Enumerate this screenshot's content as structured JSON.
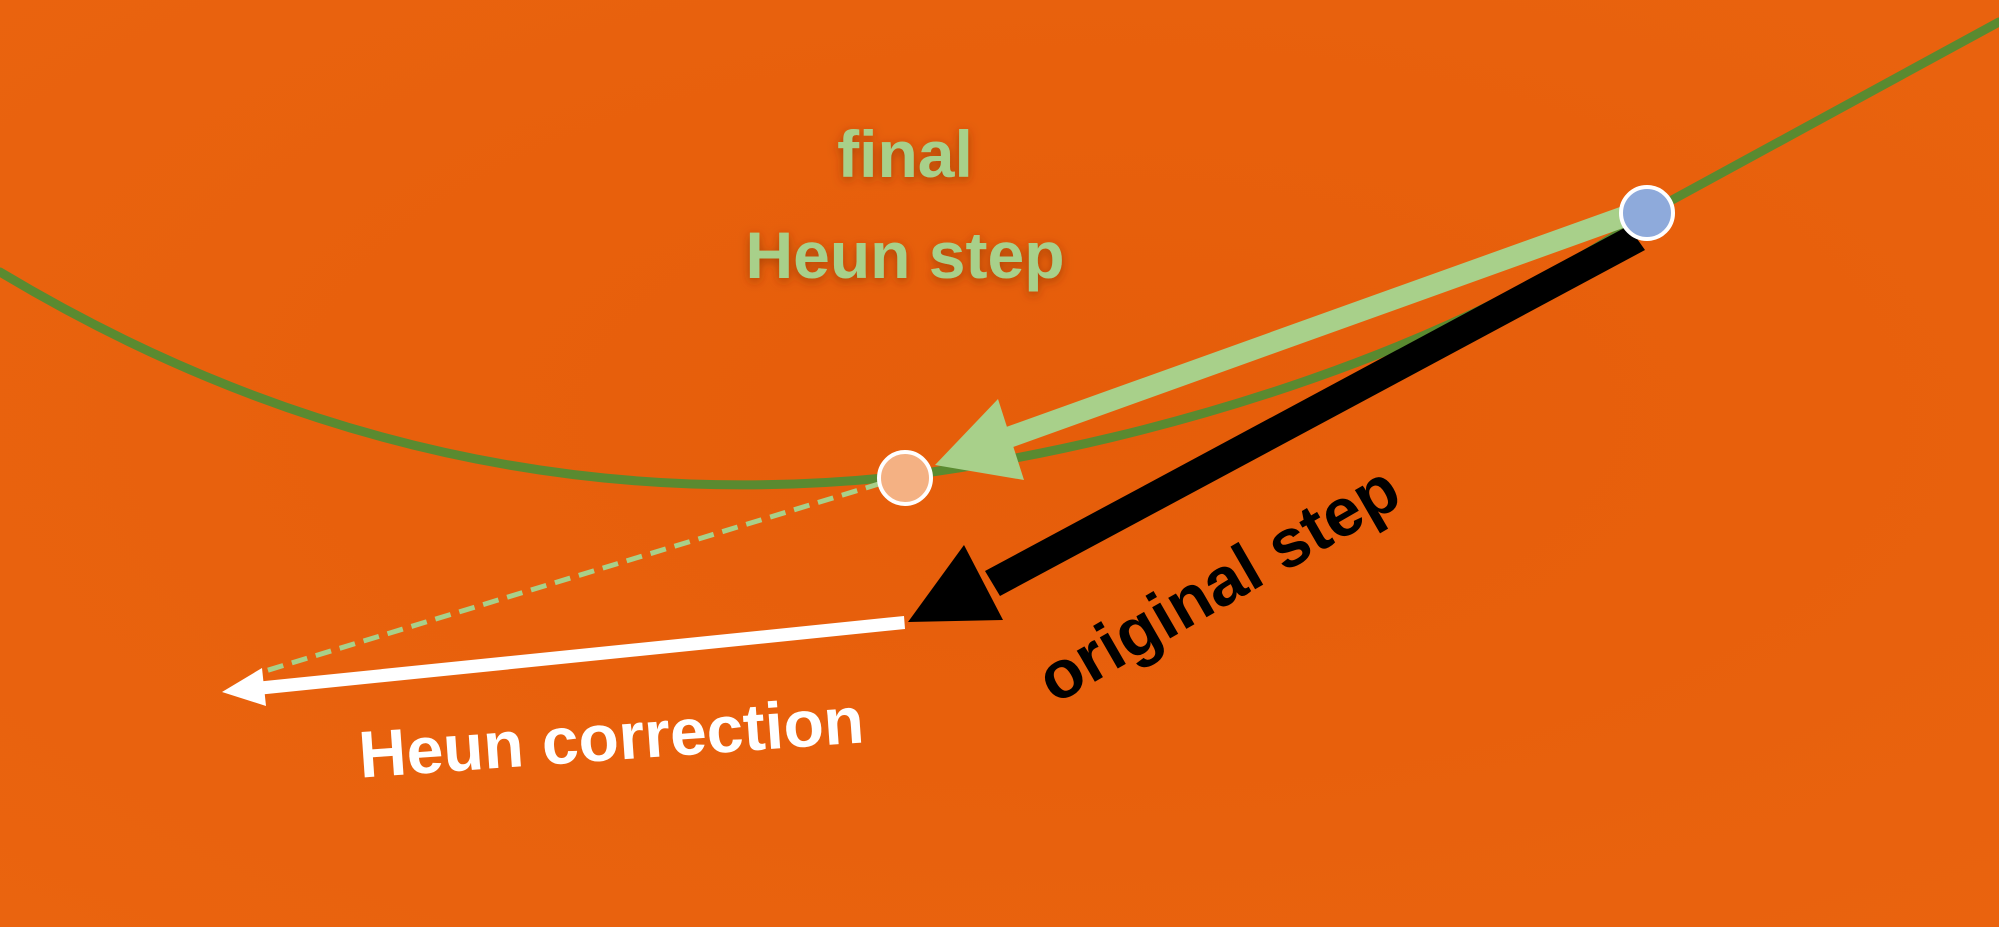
{
  "labels": {
    "final_line1": "final",
    "final_line2": "Heun step",
    "original_step": "original step",
    "heun_correction": "Heun correction"
  },
  "colors": {
    "background": "#e85e0c",
    "curve": "#5a8a30",
    "final_step": "#a8d08a",
    "original_step": "#000000",
    "correction": "#ffffff",
    "dashed": "#a8d08a",
    "start_point": "#8eaadb",
    "end_point": "#f4b183",
    "point_outline": "#ffffff"
  }
}
